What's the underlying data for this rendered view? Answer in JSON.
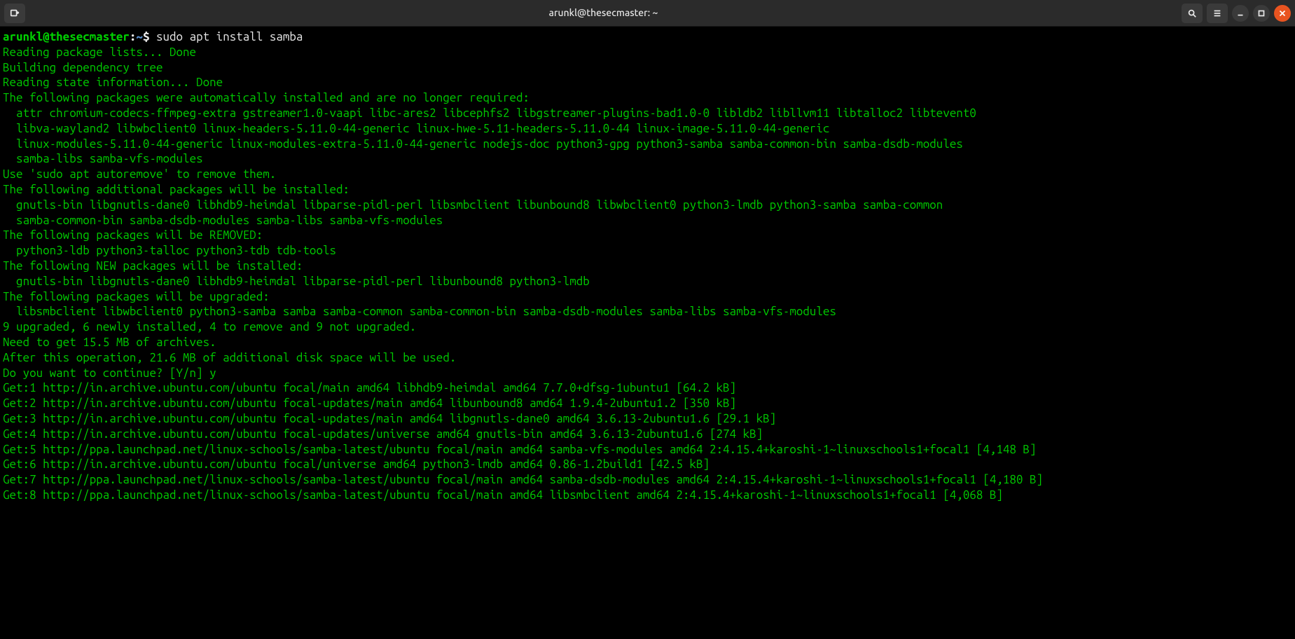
{
  "window": {
    "title": "arunkl@thesecmaster: ~"
  },
  "prompt": {
    "user_host": "arunkl@thesecmaster",
    "sep": ":",
    "path": "~",
    "symbol": "$"
  },
  "command": "sudo apt install samba",
  "user_input": "y",
  "output_lines": [
    "Reading package lists... Done",
    "Building dependency tree",
    "Reading state information... Done",
    "The following packages were automatically installed and are no longer required:",
    "  attr chromium-codecs-ffmpeg-extra gstreamer1.0-vaapi libc-ares2 libcephfs2 libgstreamer-plugins-bad1.0-0 libldb2 libllvm11 libtalloc2 libtevent0",
    "  libva-wayland2 libwbclient0 linux-headers-5.11.0-44-generic linux-hwe-5.11-headers-5.11.0-44 linux-image-5.11.0-44-generic",
    "  linux-modules-5.11.0-44-generic linux-modules-extra-5.11.0-44-generic nodejs-doc python3-gpg python3-samba samba-common-bin samba-dsdb-modules",
    "  samba-libs samba-vfs-modules",
    "Use 'sudo apt autoremove' to remove them.",
    "The following additional packages will be installed:",
    "  gnutls-bin libgnutls-dane0 libhdb9-heimdal libparse-pidl-perl libsmbclient libunbound8 libwbclient0 python3-lmdb python3-samba samba-common",
    "  samba-common-bin samba-dsdb-modules samba-libs samba-vfs-modules",
    "The following packages will be REMOVED:",
    "  python3-ldb python3-talloc python3-tdb tdb-tools",
    "The following NEW packages will be installed:",
    "  gnutls-bin libgnutls-dane0 libhdb9-heimdal libparse-pidl-perl libunbound8 python3-lmdb",
    "The following packages will be upgraded:",
    "  libsmbclient libwbclient0 python3-samba samba samba-common samba-common-bin samba-dsdb-modules samba-libs samba-vfs-modules",
    "9 upgraded, 6 newly installed, 4 to remove and 9 not upgraded.",
    "Need to get 15.5 MB of archives.",
    "After this operation, 21.6 MB of additional disk space will be used.",
    "Do you want to continue? [Y/n] y",
    "Get:1 http://in.archive.ubuntu.com/ubuntu focal/main amd64 libhdb9-heimdal amd64 7.7.0+dfsg-1ubuntu1 [64.2 kB]",
    "Get:2 http://in.archive.ubuntu.com/ubuntu focal-updates/main amd64 libunbound8 amd64 1.9.4-2ubuntu1.2 [350 kB]",
    "Get:3 http://in.archive.ubuntu.com/ubuntu focal-updates/main amd64 libgnutls-dane0 amd64 3.6.13-2ubuntu1.6 [29.1 kB]",
    "Get:4 http://in.archive.ubuntu.com/ubuntu focal-updates/universe amd64 gnutls-bin amd64 3.6.13-2ubuntu1.6 [274 kB]",
    "Get:5 http://ppa.launchpad.net/linux-schools/samba-latest/ubuntu focal/main amd64 samba-vfs-modules amd64 2:4.15.4+karoshi-1~linuxschools1+focal1 [4,148 B]",
    "Get:6 http://in.archive.ubuntu.com/ubuntu focal/universe amd64 python3-lmdb amd64 0.86-1.2build1 [42.5 kB]",
    "Get:7 http://ppa.launchpad.net/linux-schools/samba-latest/ubuntu focal/main amd64 samba-dsdb-modules amd64 2:4.15.4+karoshi-1~linuxschools1+focal1 [4,180 B]",
    "Get:8 http://ppa.launchpad.net/linux-schools/samba-latest/ubuntu focal/main amd64 libsmbclient amd64 2:4.15.4+karoshi-1~linuxschools1+focal1 [4,068 B]"
  ]
}
